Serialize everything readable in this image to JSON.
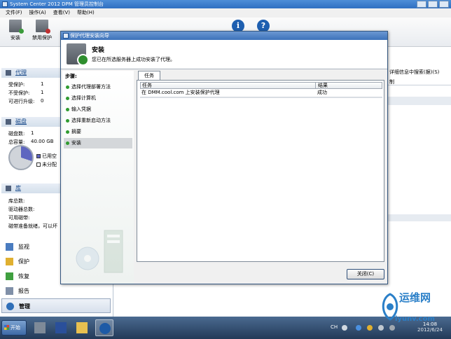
{
  "window": {
    "title": "System Center 2012 DPM 管理员控制台"
  },
  "menu": [
    {
      "label": "文件(F)"
    },
    {
      "label": "操作(A)"
    },
    {
      "label": "查看(V)"
    },
    {
      "label": "帮助(H)"
    }
  ],
  "toolbar": {
    "install_label": "安装",
    "disable_label": "禁用保护"
  },
  "left": {
    "agents": {
      "title": "代理",
      "protected_label": "受保护:",
      "protected_value": "1",
      "unprotected_label": "不受保护:",
      "unprotected_value": "1",
      "upgradable_label": "可进行升级:",
      "upgradable_value": "0"
    },
    "disks": {
      "title": "磁盘",
      "count_label": "磁盘数:",
      "count_value": "1",
      "capacity_label": "总容量:",
      "capacity_value": "40.00 GB",
      "used_label": "已用空",
      "unallocated_label": "未分配"
    },
    "library": {
      "title": "库",
      "total_label": "库总数:",
      "drives_label": "驱动器总数:",
      "available_label": "可用磁带:",
      "ready_label": "磁带准备就绪，可以坏"
    },
    "nav": [
      {
        "label": "监视"
      },
      {
        "label": "保护"
      },
      {
        "label": "恢复"
      },
      {
        "label": "报告"
      },
      {
        "label": "管理"
      }
    ]
  },
  "behind": {
    "search_label": "详细信息中搜索(据)(S)",
    "col_label": "制"
  },
  "dialog": {
    "title": "保护代理安装向导",
    "header_title": "安装",
    "header_subtitle": "您已在所选服务器上成功安装了代理。",
    "steps_label": "步骤:",
    "steps": [
      {
        "label": "选择代理部署方法"
      },
      {
        "label": "选择计算机"
      },
      {
        "label": "输入凭据"
      },
      {
        "label": "选择重新启动方法"
      },
      {
        "label": "摘要"
      },
      {
        "label": "安装"
      }
    ],
    "tab_label": "任务",
    "grid": {
      "col_task": "任务",
      "col_result": "结果",
      "rows": [
        {
          "task": "在 DMM.cool.com 上安装保护代理",
          "result": "成功"
        }
      ]
    },
    "close_label": "关闭(C)"
  },
  "taskbar": {
    "start_label": "开始",
    "lang": "CH",
    "clock_time": "14:08",
    "clock_date": "2012/6/24"
  },
  "watermark": {
    "brand": "运维网",
    "site": "iyunv.com"
  }
}
